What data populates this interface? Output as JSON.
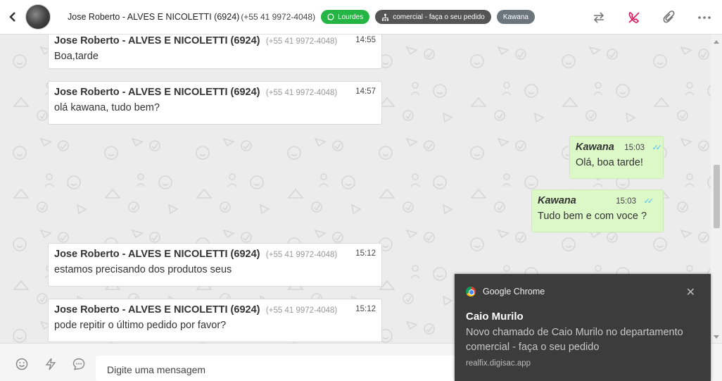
{
  "header": {
    "back_icon": "chevron-left-icon",
    "contact_name": "Jose Roberto - ALVES E NICOLETTI (6924)",
    "contact_phone": "(+55 41 9972-4048)",
    "tags": [
      {
        "label": "Lourdes",
        "icon": "whatsapp-icon",
        "color": "#25b544"
      },
      {
        "label": "comercial - faça o seu pedido",
        "icon": "department-icon",
        "color": "#555555"
      },
      {
        "label": "Kawana",
        "color": "#6c747c"
      }
    ],
    "actions": [
      "transfer-icon",
      "end-call-icon",
      "attach-icon",
      "more-icon"
    ]
  },
  "messages": [
    {
      "direction": "in",
      "sender": "Jose Roberto - ALVES E NICOLETTI (6924)",
      "phone": "(+55 41 9972-4048)",
      "time": "14:55",
      "text": "Boa,tarde"
    },
    {
      "direction": "in",
      "sender": "Jose Roberto - ALVES E NICOLETTI (6924)",
      "phone": "(+55 41 9972-4048)",
      "time": "14:57",
      "text": "olá kawana, tudo bem?"
    },
    {
      "direction": "out",
      "sender": "Kawana",
      "time": "15:03",
      "text": "Olá, boa tarde!",
      "status": "read"
    },
    {
      "direction": "out",
      "sender": "Kawana",
      "time": "15:03",
      "text": "Tudo bem e com voce ?",
      "status": "read"
    },
    {
      "direction": "in",
      "sender": "Jose Roberto - ALVES E NICOLETTI (6924)",
      "phone": "(+55 41 9972-4048)",
      "time": "15:12",
      "text": "estamos precisando dos produtos seus"
    },
    {
      "direction": "in",
      "sender": "Jose Roberto - ALVES E NICOLETTI (6924)",
      "phone": "(+55 41 9972-4048)",
      "time": "15:12",
      "text": "pode repitir o último pedido por favor?"
    }
  ],
  "composer": {
    "placeholder": "Digite uma mensagem",
    "icons": [
      "emoji-icon",
      "flash-icon",
      "quick-reply-icon"
    ]
  },
  "notification": {
    "app": "Google Chrome",
    "title": "Caio Murilo",
    "body": "Novo chamado de Caio Murilo no departamento comercial - faça o seu pedido",
    "url": "realfix.digisac.app"
  },
  "colors": {
    "outgoing_bubble": "#dcf8c6",
    "read_ticks": "#4fc3f7",
    "end_call": "#d81b60"
  }
}
